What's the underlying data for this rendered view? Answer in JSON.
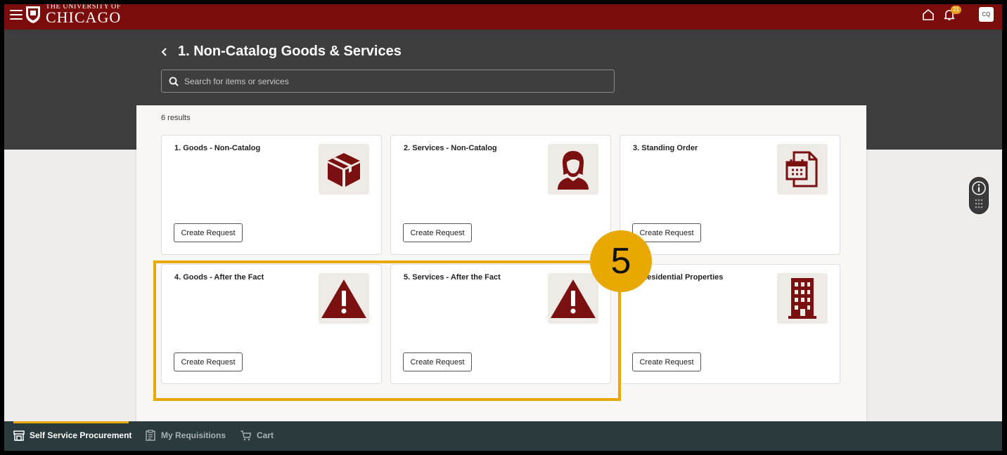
{
  "header": {
    "logo_line1": "THE UNIVERSITY OF",
    "logo_line2": "CHICAGO",
    "notification_count": "21",
    "avatar_initials": "CQ"
  },
  "page": {
    "title": "1. Non-Catalog Goods & Services",
    "search_placeholder": "Search for items or services",
    "results_count": "6 results"
  },
  "cards": [
    {
      "title": "1. Goods - Non-Catalog",
      "icon": "box-icon",
      "button": "Create Request"
    },
    {
      "title": "2. Services - Non-Catalog",
      "icon": "person-icon",
      "button": "Create Request"
    },
    {
      "title": "3. Standing Order",
      "icon": "calendar-document-icon",
      "button": "Create Request"
    },
    {
      "title": "4. Goods - After the Fact",
      "icon": "warning-icon",
      "button": "Create Request"
    },
    {
      "title": "5. Services - After the Fact",
      "icon": "warning-icon",
      "button": "Create Request"
    },
    {
      "title": "6. Residential Properties",
      "icon": "building-icon",
      "button": "Create Request"
    }
  ],
  "callout": {
    "number": "5",
    "color": "#e8a800"
  },
  "bottom_nav": {
    "self_service": "Self Service Procurement",
    "my_requisitions": "My Requisitions",
    "cart": "Cart"
  },
  "colors": {
    "brand_maroon": "#7a0c0c",
    "icon_maroon": "#7b1010",
    "header_band": "#3e3e3e",
    "bottom_bar": "#2b3a3c",
    "accent": "#e8a800"
  }
}
